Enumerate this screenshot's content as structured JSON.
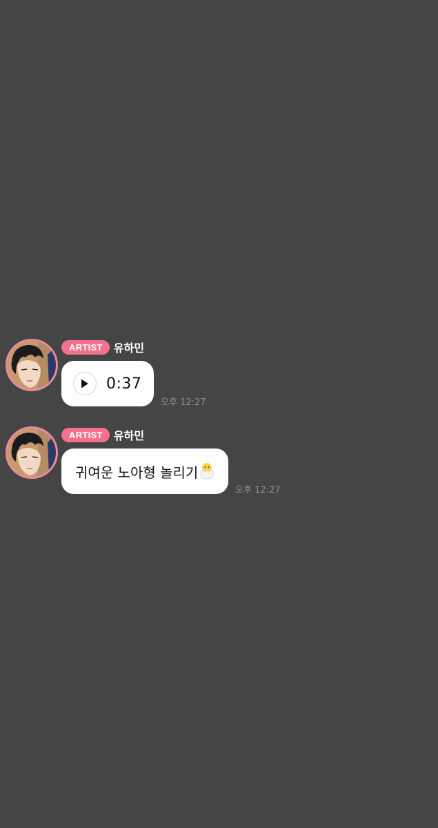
{
  "messages": [
    {
      "badge": "ARTIST",
      "sender": "유하민",
      "type": "voice",
      "duration": "0:37",
      "time": "오후 12:27"
    },
    {
      "badge": "ARTIST",
      "sender": "유하민",
      "type": "text",
      "text": "귀여운 노아형 놀리기",
      "emoji": "hatching-chick-emoji",
      "time": "오후 12:27"
    }
  ],
  "colors": {
    "background": "#454545",
    "badge": "#f3718d",
    "avatar_ring": "#e8899f",
    "bubble": "#ffffff",
    "timestamp": "#8e8e8e"
  },
  "icons": {
    "play": "play-icon",
    "avatar": "profile-avatar"
  }
}
